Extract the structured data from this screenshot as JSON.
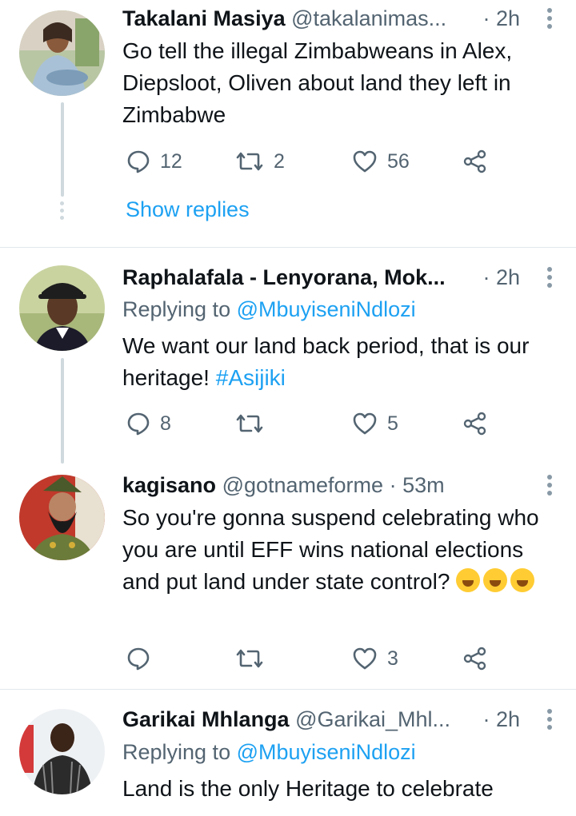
{
  "tweets": [
    {
      "name": "Takalani Masiya",
      "handle": "@takalanimas...",
      "time": "· 2h",
      "reply_to": null,
      "text": "Go tell the illegal Zimbabweans in Alex, Diepsloot, Oliven about land they left in Zimbabwe",
      "replies": "12",
      "retweets": "2",
      "likes": "56",
      "show_replies": "Show replies"
    },
    {
      "name": "Raphalafala - Lenyorana, Mok...",
      "handle": "",
      "time": "· 2h",
      "reply_to_prefix": "Replying to",
      "reply_to_handle": "@MbuyiseniNdlozi",
      "text": "We want our land back period, that is our heritage!",
      "hashtag": "#Asijiki",
      "replies": "8",
      "retweets": "",
      "likes": "5"
    },
    {
      "name": "kagisano",
      "handle": "@gotnameforme",
      "time": "· 53m",
      "text": "So you're gonna suspend celebrating who you are until EFF wins national elections and put land under state control?",
      "emoji": "🤣🤣🤣",
      "replies": "",
      "retweets": "",
      "likes": "3"
    },
    {
      "name": "Garikai Mhlanga",
      "handle": "@Garikai_Mhl...",
      "time": "· 2h",
      "reply_to_prefix": "Replying to",
      "reply_to_handle": "@MbuyiseniNdlozi",
      "text": "Land is the only Heritage to celebrate"
    }
  ],
  "icons": {
    "reply": "speech-bubble-icon",
    "retweet": "retweet-arrows-icon",
    "like": "heart-icon",
    "share": "share-nodes-icon",
    "more": "vertical-ellipsis-icon"
  },
  "colors": {
    "link": "#1da1f2",
    "secondary_text": "#536471",
    "divider": "#e1e8ed",
    "thread_line": "#cfd9de"
  }
}
